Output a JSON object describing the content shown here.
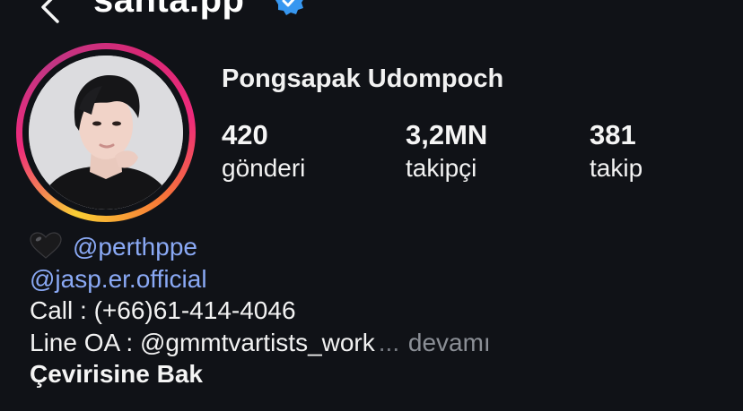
{
  "header": {
    "username": "santa.pp"
  },
  "profile": {
    "display_name": "Pongsapak Udompoch",
    "stats": [
      {
        "value": "420",
        "label": "gönderi"
      },
      {
        "value": "3,2MN",
        "label": "takipçi"
      },
      {
        "value": "381",
        "label": "takip"
      }
    ]
  },
  "bio": {
    "mention_1": "@perthppe",
    "mention_2": "@jasp.er.official",
    "call_line": "Call : (+66)61-414-4046",
    "line_oa": "Line OA : @gmmtvartists_work",
    "ellipsis": "...",
    "more_label": "devamı",
    "translate_label": "Çevirisine Bak"
  },
  "colors": {
    "background": "#101217",
    "link": "#8aa9f5",
    "verified": "#3797f0",
    "muted": "#8b8f96"
  },
  "icons": {
    "back": "chevron-left-icon",
    "verified": "verified-badge-icon",
    "heart": "black-heart-icon"
  }
}
